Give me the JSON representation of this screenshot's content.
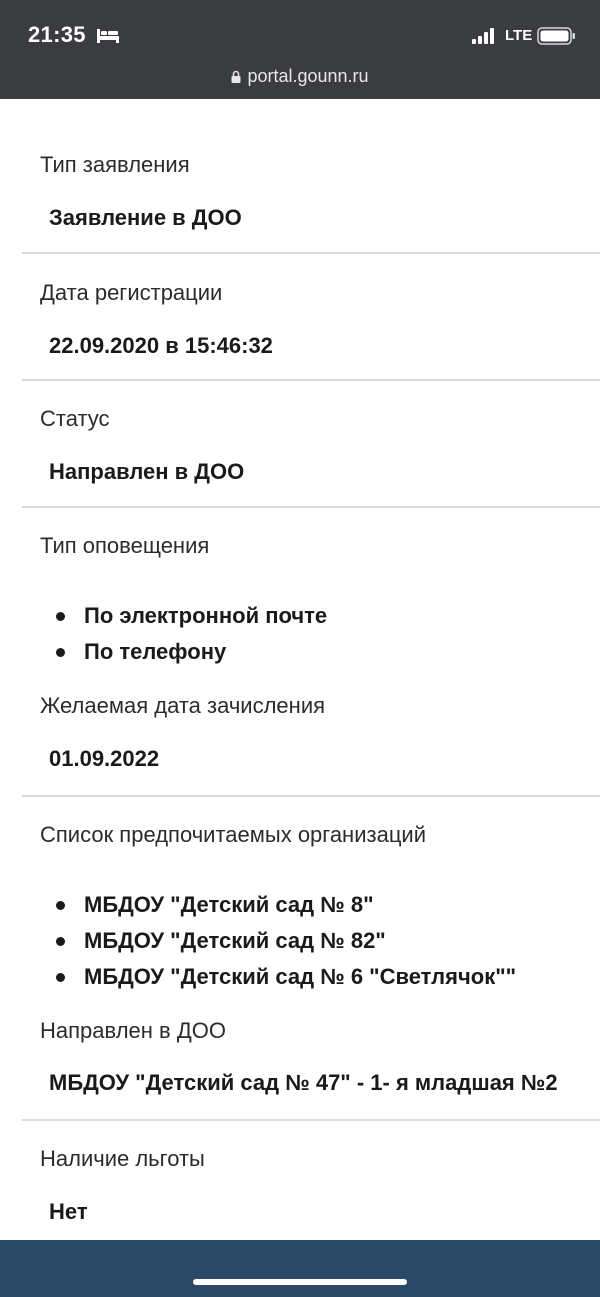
{
  "status_bar": {
    "time": "21:35",
    "network": "LTE",
    "icons": [
      "bed-icon",
      "signal-icon",
      "battery-icon"
    ]
  },
  "browser": {
    "url": "portal.gounn.ru",
    "lock_icon": "lock-icon"
  },
  "fields": {
    "application_type": {
      "label": "Тип заявления",
      "value": "Заявление в ДОО"
    },
    "registration_date": {
      "label": "Дата регистрации",
      "value": "22.09.2020 в 15:46:32"
    },
    "status": {
      "label": "Статус",
      "value": "Направлен в ДОО"
    },
    "notification_type": {
      "label": "Тип оповещения",
      "items": [
        "По электронной почте",
        "По телефону"
      ]
    },
    "desired_date": {
      "label": "Желаемая дата зачисления",
      "value": "01.09.2022"
    },
    "preferred_orgs": {
      "label": "Список предпочитаемых организаций",
      "items": [
        "МБДОУ \"Детский сад № 8\"",
        "МБДОУ \"Детский сад № 82\"",
        "МБДОУ \"Детский сад № 6 \"Светлячок\"\""
      ]
    },
    "assigned_doo": {
      "label": "Направлен в ДОО",
      "value": "МБДОУ \"Детский сад № 47\" - 1- я младшая №2"
    },
    "benefit": {
      "label": "Наличие льготы",
      "value": "Нет"
    }
  },
  "colors": {
    "topbar": "#3a3c3f",
    "bottombar": "#2c4a68",
    "divider": "#d9d9d9"
  }
}
